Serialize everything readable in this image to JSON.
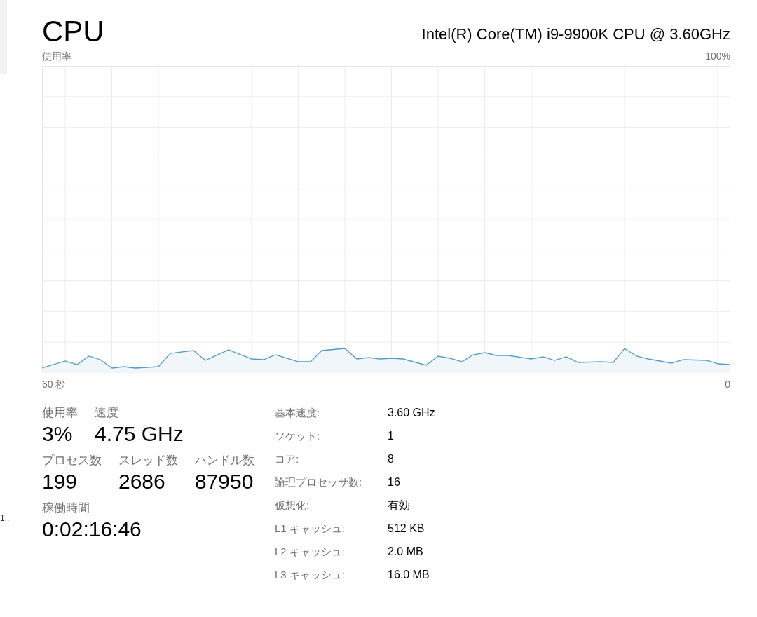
{
  "sidebar": {
    "items": [
      {
        "selected": true
      },
      {
        "label": "1..",
        "selected": false
      }
    ]
  },
  "header": {
    "title": "CPU",
    "model": "Intel(R) Core(TM) i9-9900K CPU @ 3.60GHz"
  },
  "graph": {
    "label": "使用率",
    "max_label": "100%",
    "x_start": "60 秒",
    "x_end": "0"
  },
  "stats": [
    {
      "label": "使用率",
      "value": "3%"
    },
    {
      "label": "速度",
      "value": "4.75 GHz"
    },
    {
      "label": "プロセス数",
      "value": "199"
    },
    {
      "label": "スレッド数",
      "value": "2686"
    },
    {
      "label": "ハンドル数",
      "value": "87950"
    },
    {
      "label": "稼働時間",
      "value": "0:02:16:46"
    }
  ],
  "details": [
    {
      "label": "基本速度:",
      "value": "3.60 GHz"
    },
    {
      "label": "ソケット:",
      "value": "1"
    },
    {
      "label": "コア:",
      "value": "8"
    },
    {
      "label": "論理プロセッサ数:",
      "value": "16"
    },
    {
      "label": "仮想化:",
      "value": "有効"
    },
    {
      "label": "L1 キャッシュ:",
      "value": "512 KB"
    },
    {
      "label": "L2 キャッシュ:",
      "value": "2.0 MB"
    },
    {
      "label": "L3 キャッシュ:",
      "value": "16.0 MB"
    }
  ]
}
